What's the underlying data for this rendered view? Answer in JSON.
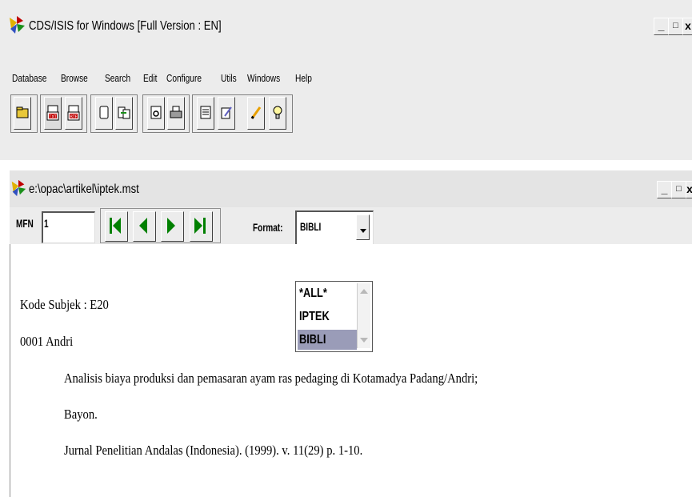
{
  "app": {
    "title": "CDS/ISIS for Windows [Full Version : EN]",
    "window_buttons": {
      "minimize": "_",
      "maximize": "□",
      "close": "x"
    }
  },
  "menu": [
    "Database",
    "Browse",
    "Search",
    "Edit",
    "Configure",
    "Utils",
    "Windows",
    "Help"
  ],
  "toolbar": {
    "icons": [
      "open-database-icon",
      "txt-export-icon",
      "rtf-export-icon",
      "single-record-icon",
      "copy-records-icon",
      "preview-icon",
      "print-icon",
      "form-icon",
      "edit-record-icon",
      "pencil-icon",
      "lightbulb-icon"
    ],
    "txt_label": "TXT",
    "rtf_label": "RTF"
  },
  "child_window": {
    "title": "e:\\opac\\artikel\\iptek.mst",
    "window_buttons": {
      "minimize": "_",
      "maximize": "□",
      "close": "x"
    },
    "mfn_label": "MFN",
    "mfn_value": "1",
    "format_label": "Format:",
    "format_value": "BIBLI",
    "format_options": [
      "*ALL*",
      "IPTEK",
      "BIBLI"
    ],
    "selected_option": "BIBLI"
  },
  "record": {
    "subject_line": "Kode Subjek : E20",
    "author_line": "0001  Andri",
    "title_line1": "Analisis biaya produksi dan pemasaran ayam ras pedaging di Kotamadya Padang/Andri;",
    "title_line2": "Bayon.",
    "source_line": "Jurnal Penelitian Andalas (Indonesia).  (1999).  v. 11(29) p. 1-10."
  }
}
